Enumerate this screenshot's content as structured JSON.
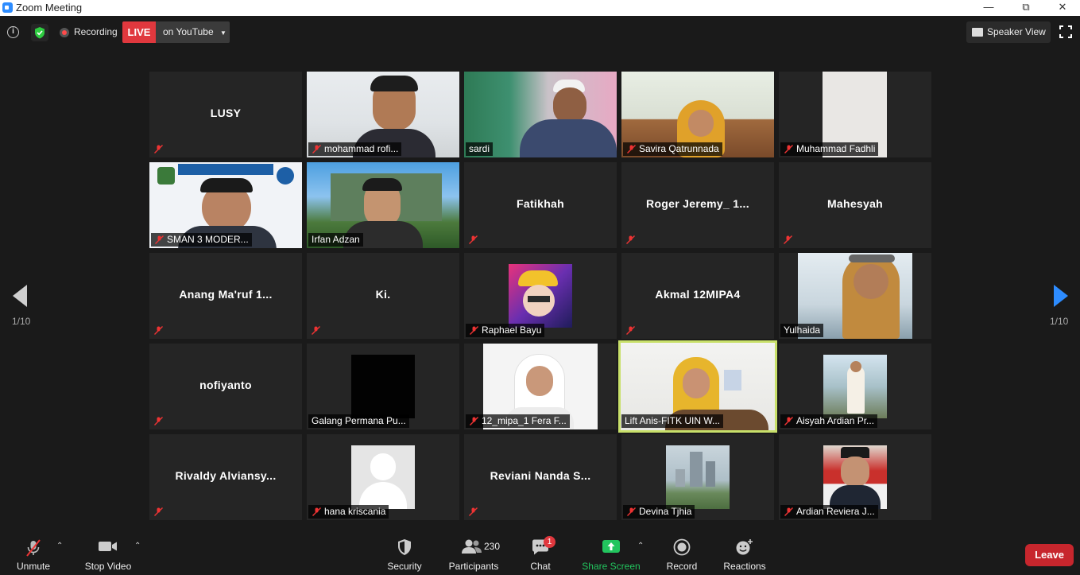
{
  "window": {
    "title": "Zoom Meeting"
  },
  "topbar": {
    "recording_label": "Recording",
    "live_label": "LIVE",
    "live_destination": "on YouTube",
    "view_label": "Speaker View"
  },
  "pagination": {
    "left_indicator": "1/10",
    "right_indicator": "1/10"
  },
  "participants": [
    {
      "name": "LUSY",
      "label": "",
      "video": false
    },
    {
      "name": "",
      "label": "mohammad rofi...",
      "video": true
    },
    {
      "name": "",
      "label": "sardi",
      "video": true
    },
    {
      "name": "",
      "label": "Savira Qatrunnada",
      "video": true
    },
    {
      "name": "",
      "label": "Muhammad Fadhli",
      "video": true
    },
    {
      "name": "",
      "label": "SMAN 3 MODER...",
      "video": true
    },
    {
      "name": "",
      "label": "Irfan Adzan",
      "video": true
    },
    {
      "name": "Fatikhah",
      "label": "",
      "video": false
    },
    {
      "name": "Roger Jeremy_ 1...",
      "label": "",
      "video": false
    },
    {
      "name": "Mahesyah",
      "label": "",
      "video": false
    },
    {
      "name": "Anang Ma'ruf 1...",
      "label": "",
      "video": false
    },
    {
      "name": "Ki.",
      "label": "",
      "video": false
    },
    {
      "name": "",
      "label": "Raphael Bayu",
      "video": true
    },
    {
      "name": "Akmal 12MIPA4",
      "label": "",
      "video": false
    },
    {
      "name": "",
      "label": "Yulhaida",
      "video": true
    },
    {
      "name": "nofiyanto",
      "label": "",
      "video": false
    },
    {
      "name": "",
      "label": "Galang Permana Pu...",
      "video": true
    },
    {
      "name": "",
      "label": "12_mipa_1 Fera F...",
      "video": true
    },
    {
      "name": "",
      "label": "Lift Anis-FITK UIN W...",
      "video": true
    },
    {
      "name": "",
      "label": "Aisyah Ardian Pr...",
      "video": true
    },
    {
      "name": "Rivaldy  Alviansy...",
      "label": "",
      "video": false
    },
    {
      "name": "",
      "label": "hana kriscania",
      "video": true
    },
    {
      "name": "Reviani  Nanda S...",
      "label": "",
      "video": false
    },
    {
      "name": "",
      "label": "Devina Tjhia",
      "video": true
    },
    {
      "name": "",
      "label": "Ardian Reviera J...",
      "video": true
    }
  ],
  "toolbar": {
    "unmute": "Unmute",
    "stop_video": "Stop Video",
    "security": "Security",
    "participants": "Participants",
    "participants_count": "230",
    "chat": "Chat",
    "chat_badge": "1",
    "share_screen": "Share Screen",
    "record": "Record",
    "reactions": "Reactions",
    "leave": "Leave"
  },
  "colors": {
    "accent_blue": "#2d8cff",
    "live_red": "#e0383e",
    "share_green": "#22c55e",
    "active_speaker": "#c8e06a",
    "leave_red": "#c7262d"
  }
}
